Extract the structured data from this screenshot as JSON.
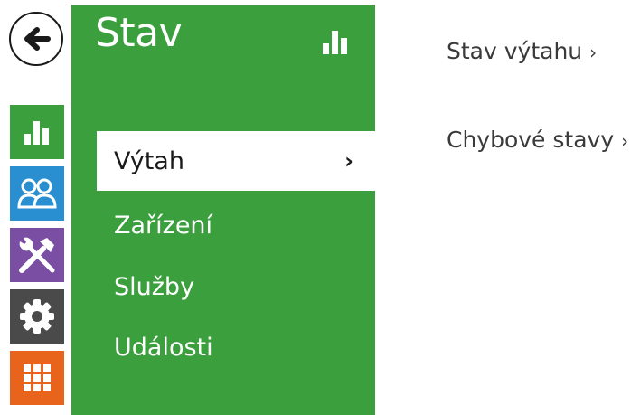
{
  "nav": {
    "back_icon": "arrow-left-icon",
    "rail": [
      {
        "name": "status",
        "icon": "bar-chart-icon",
        "color": "#3c9f3e"
      },
      {
        "name": "directory",
        "icon": "users-icon",
        "color": "#2a8fd0"
      },
      {
        "name": "hardware",
        "icon": "tools-icon",
        "color": "#7a4ea3"
      },
      {
        "name": "system",
        "icon": "gear-icon",
        "color": "#4a4a4a"
      },
      {
        "name": "services",
        "icon": "grid-icon",
        "color": "#e8641d"
      }
    ]
  },
  "panel": {
    "title": "Stav",
    "title_icon": "bar-chart-icon",
    "background": "#3c9f3e",
    "items": [
      {
        "label": "Výtah",
        "active": true
      },
      {
        "label": "Zařízení",
        "active": false
      },
      {
        "label": "Služby",
        "active": false
      },
      {
        "label": "Události",
        "active": false
      }
    ],
    "chevron": "›"
  },
  "content": {
    "links": [
      {
        "label": "Stav výtahu",
        "chevron": "›"
      },
      {
        "label": "Chybové stavy",
        "chevron": "›"
      }
    ]
  }
}
